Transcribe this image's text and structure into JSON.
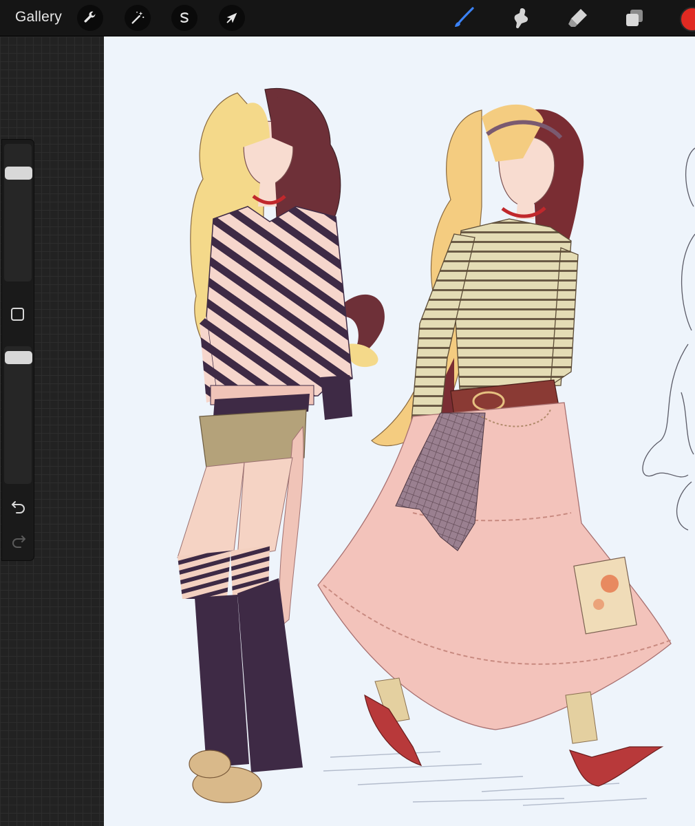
{
  "app": {
    "gallery_label": "Gallery"
  },
  "toolbar": {
    "left_tools": [
      {
        "name": "actions",
        "icon": "wrench-icon"
      },
      {
        "name": "adjustments",
        "icon": "magic-wand-icon"
      },
      {
        "name": "selection",
        "icon": "selection-s-icon"
      },
      {
        "name": "transform",
        "icon": "arrow-cursor-icon"
      }
    ],
    "right_tools": [
      {
        "name": "brush",
        "icon": "brush-icon",
        "active": true
      },
      {
        "name": "smudge",
        "icon": "smudge-finger-icon"
      },
      {
        "name": "eraser",
        "icon": "eraser-icon"
      },
      {
        "name": "layers",
        "icon": "layers-icon"
      }
    ],
    "current_color": "#e02a22",
    "active_color": "#3b82f6"
  },
  "sidebar": {
    "brush_size_level": 0.82,
    "opacity_level": 0.96
  },
  "canvas": {
    "background": "#eef4fb",
    "artwork": "character-sketch-illustration"
  }
}
